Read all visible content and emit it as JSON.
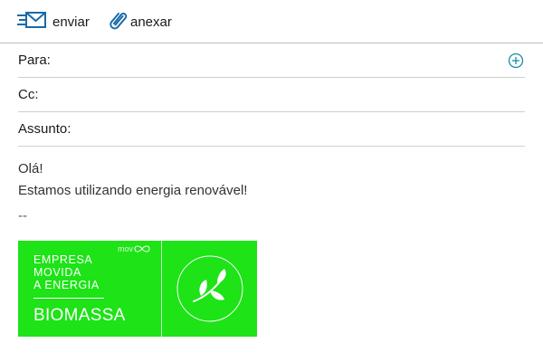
{
  "toolbar": {
    "send_label": "enviar",
    "attach_label": "anexar"
  },
  "fields": {
    "to_label": "Para:",
    "to_value": "",
    "cc_label": "Cc:",
    "cc_value": "",
    "subject_label": "Assunto:",
    "subject_value": ""
  },
  "body": {
    "line1": "Olá!",
    "line2": "Estamos utilizando energia renovável!",
    "signature_separator": "--"
  },
  "banner": {
    "line1": "EMPRESA",
    "line2": "MOVIDA",
    "line3": "A ENERGIA",
    "headline": "BIOMASSA",
    "brand": "mov",
    "background_color": "#1de317"
  },
  "icons": {
    "send": "envelope-send-icon",
    "attach": "paperclip-icon",
    "add_contact": "add-circle-icon",
    "leaf": "leaf-icon"
  },
  "colors": {
    "icon_blue": "#1a6aa8",
    "add_icon": "#1a8aa8"
  }
}
